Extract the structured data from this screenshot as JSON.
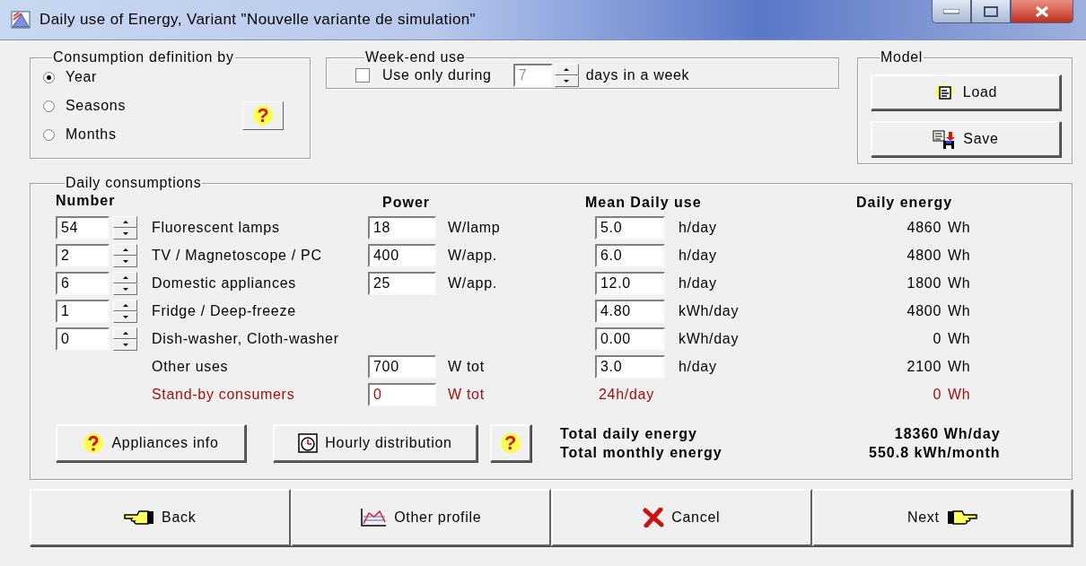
{
  "window": {
    "title": "Daily use of Energy, Variant  \"Nouvelle variante de simulation\""
  },
  "consumption_definition": {
    "label": "Consumption definition by",
    "options": [
      {
        "label": "Year",
        "selected": true
      },
      {
        "label": "Seasons",
        "selected": false
      },
      {
        "label": "Months",
        "selected": false
      }
    ],
    "help": "?"
  },
  "weekend_use": {
    "label": "Week-end use",
    "checkbox": {
      "label": "Use only during",
      "checked": false
    },
    "days": {
      "value": "7",
      "disabled": true
    },
    "suffix": "days in a week"
  },
  "model": {
    "label": "Model",
    "buttons": [
      {
        "kind": "load",
        "label": "Load"
      },
      {
        "kind": "save",
        "label": "Save"
      }
    ]
  },
  "daily_consumptions": {
    "label": "Daily consumptions",
    "columns": [
      "Number",
      "Power",
      "Mean Daily use",
      "Daily energy"
    ],
    "rows": [
      {
        "kind": "normal",
        "number": "54",
        "name": "Fluorescent lamps",
        "power": "18",
        "power_unit": "W/lamp",
        "use": "5.0",
        "use_unit": "h/day",
        "energy": "4860",
        "energy_unit": "Wh"
      },
      {
        "kind": "normal",
        "number": "2",
        "name": "TV / Magnetoscope / PC",
        "power": "400",
        "power_unit": "W/app.",
        "use": "6.0",
        "use_unit": "h/day",
        "energy": "4800",
        "energy_unit": "Wh"
      },
      {
        "kind": "normal",
        "number": "6",
        "name": "Domestic appliances",
        "power": "25",
        "power_unit": "W/app.",
        "use": "12.0",
        "use_unit": "h/day",
        "energy": "1800",
        "energy_unit": "Wh"
      },
      {
        "kind": "normal",
        "number": "1",
        "name": "Fridge / Deep-freeze",
        "use": "4.80",
        "use_unit": "kWh/day",
        "energy": "4800",
        "energy_unit": "Wh"
      },
      {
        "kind": "normal",
        "number": "0",
        "name": "Dish-washer,  Cloth-washer",
        "use": "0.00",
        "use_unit": "kWh/day",
        "energy": "0",
        "energy_unit": "Wh"
      },
      {
        "kind": "normal",
        "name": "Other uses",
        "power": "700",
        "power_unit": "W tot",
        "use": "3.0",
        "use_unit": "h/day",
        "energy": "2100",
        "energy_unit": "Wh"
      },
      {
        "kind": "standby",
        "name": "Stand-by consumers",
        "power": "0",
        "power_unit": "W tot",
        "use": "24h/day",
        "energy": "0",
        "energy_unit": "Wh"
      }
    ],
    "buttons": [
      {
        "kind": "info",
        "label": "Appliances info"
      },
      {
        "kind": "hourly",
        "label": "Hourly distribution"
      },
      {
        "kind": "help",
        "label": "?"
      }
    ],
    "totals": [
      {
        "label": "Total daily energy",
        "value": "18360 Wh/day"
      },
      {
        "label": "Total monthly energy",
        "value": "550.8 kWh/month"
      }
    ]
  },
  "footer_buttons": [
    {
      "kind": "back",
      "label": "Back"
    },
    {
      "kind": "profile",
      "label": "Other profile"
    },
    {
      "kind": "cancel",
      "label": "Cancel"
    },
    {
      "kind": "next",
      "label": "Next"
    }
  ]
}
